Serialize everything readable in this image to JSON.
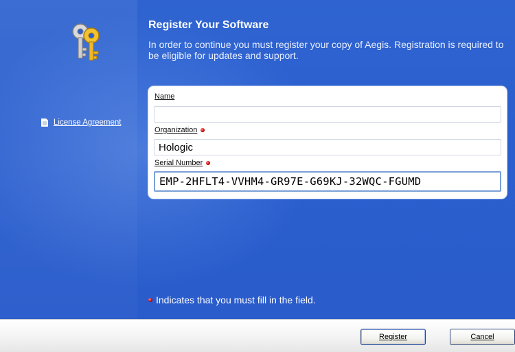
{
  "sidebar": {
    "license_link": "License Agreement"
  },
  "header": {
    "title": "Register Your Software",
    "description": "In order to continue you must register your copy of Aegis. Registration is required to be eligible for updates and support."
  },
  "form": {
    "name": {
      "label": "Name",
      "value": ""
    },
    "organization": {
      "label": "Organization",
      "value": "Hologic",
      "required": true
    },
    "serial": {
      "label": "Serial Number",
      "value": "EMP-2HFLT4-VVHM4-GR97E-G69KJ-32WQC-FGUMD",
      "required": true
    }
  },
  "legend": "Indicates that you must fill in the field.",
  "buttons": {
    "register": "Register",
    "cancel": "Cancel"
  },
  "colors": {
    "background": "#2b5fcf",
    "required_dot": "#c00000"
  },
  "icons": [
    "keys-icon",
    "document-icon",
    "required-dot-icon"
  ]
}
